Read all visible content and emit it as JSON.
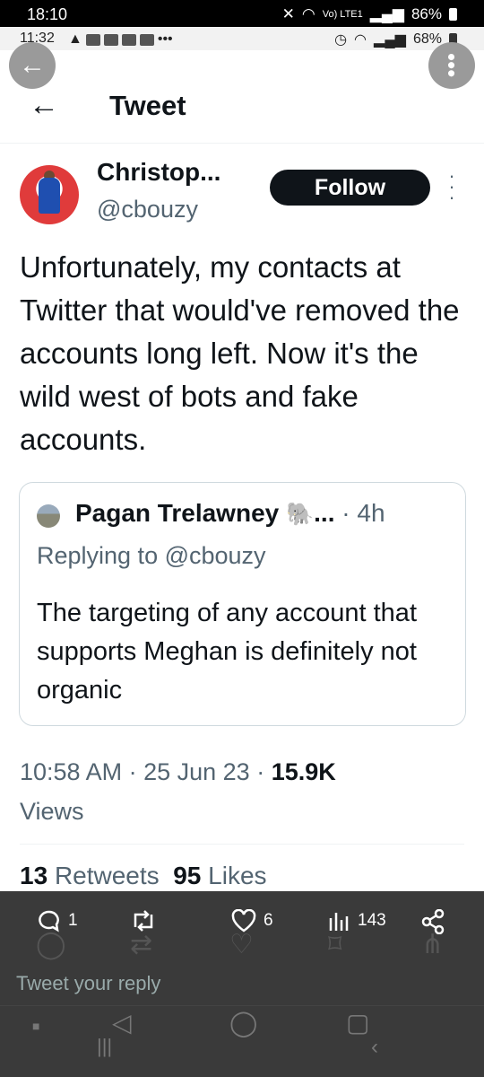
{
  "status_outer": {
    "time": "18:10",
    "net": "Vo) LTE1",
    "battery": "86%"
  },
  "status_inner": {
    "time": "11:32",
    "battery": "68%"
  },
  "header": {
    "title": "Tweet"
  },
  "tweet": {
    "author_name": "Christop...",
    "author_handle": "@cbouzy",
    "follow_label": "Follow",
    "text": "Unfortunately, my contacts at Twitter that would've removed the accounts long left. Now it's the wild west of bots and fake accounts.",
    "time": "10:58 AM",
    "date": "25 Jun 23",
    "views_count": "15.9K",
    "views_label": "Views",
    "retweets_count": "13",
    "retweets_label": "Retweets",
    "likes_count": "95",
    "likes_label": "Likes"
  },
  "quote": {
    "name": "Pagan Trelawney",
    "emoji": "🐘",
    "ellipsis": "...",
    "time": "4h",
    "replying": "Replying to @cbouzy",
    "text": "The targeting of any account that supports Meghan is definitely not organic"
  },
  "actions": {
    "replies": "1",
    "likes": "6",
    "views": "143"
  },
  "reply_placeholder": "Tweet your reply"
}
